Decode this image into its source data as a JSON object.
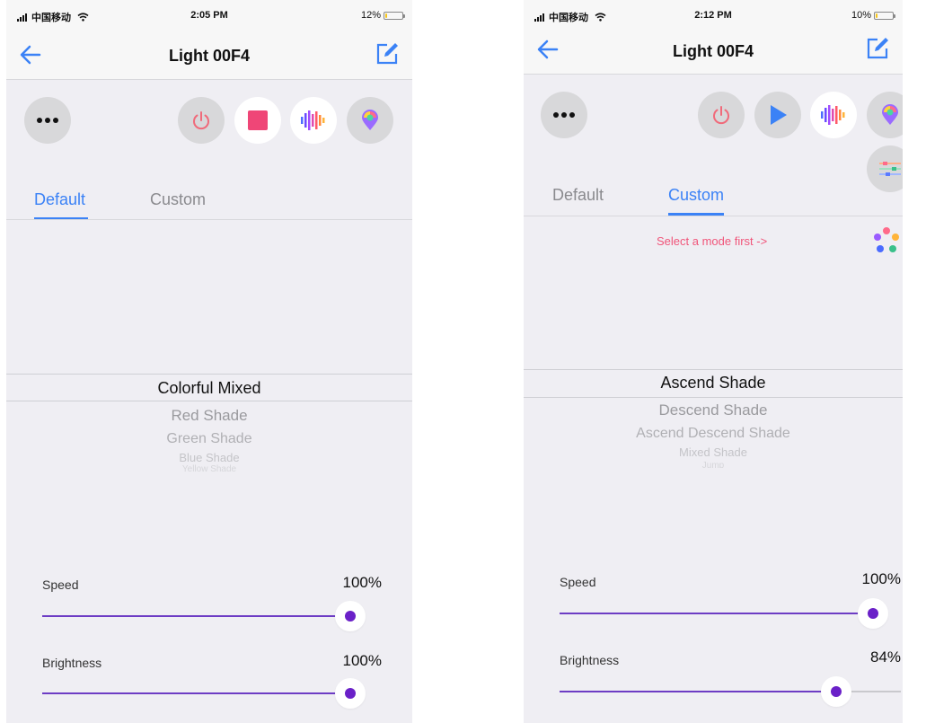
{
  "colors": {
    "accent": "#3b82f6",
    "slider": "#6d3cc4",
    "thumb_dot": "#6a20c8",
    "power": "#f06a7a",
    "stop": "#ef4677",
    "hint": "#f0557a",
    "battery": "#f5c518"
  },
  "screens": [
    {
      "status_bar": {
        "carrier": "中国移动",
        "time": "2:05 PM",
        "battery": "12%",
        "battery_level": 0.12
      },
      "nav": {
        "title": "Light 00F4",
        "back_icon": "arrow-left-icon",
        "edit_icon": "edit-icon"
      },
      "controls": {
        "more_icon": "more-dots-icon",
        "power_icon": "power-icon",
        "playback_icon": "stop-icon",
        "music_icon": "music-bars-icon",
        "color_icon": "color-pin-icon"
      },
      "tabs": [
        {
          "label": "Default",
          "active": true
        },
        {
          "label": "Custom",
          "active": false
        }
      ],
      "picker": {
        "selected": "Colorful Mixed",
        "items": [
          "Red Shade",
          "Green Shade",
          "Blue Shade",
          "Yellow Shade"
        ]
      },
      "sliders": [
        {
          "label": "Speed",
          "value": "100%",
          "fraction": 1.0
        },
        {
          "label": "Brightness",
          "value": "100%",
          "fraction": 1.0
        }
      ]
    },
    {
      "status_bar": {
        "carrier": "中国移动",
        "time": "2:12 PM",
        "battery": "10%",
        "battery_level": 0.1
      },
      "nav": {
        "title": "Light 00F4",
        "back_icon": "arrow-left-icon",
        "edit_icon": "edit-icon"
      },
      "controls": {
        "more_icon": "more-dots-icon",
        "power_icon": "power-icon",
        "playback_icon": "play-icon",
        "music_icon": "music-bars-icon",
        "color_icon": "color-pin-icon",
        "adjust_icon": "sliders-icon"
      },
      "tabs": [
        {
          "label": "Default",
          "active": false
        },
        {
          "label": "Custom",
          "active": true
        }
      ],
      "hint": "Select a mode first ->",
      "palette_icon": "palette-dots-icon",
      "picker": {
        "selected": "Ascend Shade",
        "items": [
          "Descend Shade",
          "Ascend Descend Shade",
          "Mixed Shade",
          "Jump"
        ]
      },
      "sliders": [
        {
          "label": "Speed",
          "value": "100%",
          "fraction": 1.0
        },
        {
          "label": "Brightness",
          "value": "84%",
          "fraction": 0.84
        }
      ]
    }
  ]
}
